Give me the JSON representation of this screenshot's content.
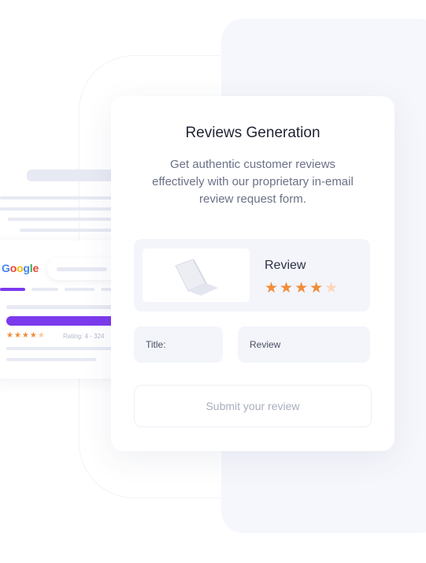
{
  "google_mock": {
    "logo": [
      "G",
      "o",
      "o",
      "g",
      "l",
      "e"
    ],
    "rating_text": "Rating: 4 - 324",
    "stars": "★★★★",
    "star_dim": "★"
  },
  "card": {
    "title": "Reviews Generation",
    "description": "Get authentic customer reviews effectively with our proprietary in-email review request form.",
    "review_label": "Review",
    "rating": 4,
    "rating_max": 5,
    "stars_filled": "★★★★",
    "star_empty": "★",
    "title_field": "Title:",
    "review_field": "Review",
    "submit_label": "Submit your review"
  },
  "colors": {
    "accent_purple": "#7c3aed",
    "star_orange": "#f28c38"
  }
}
